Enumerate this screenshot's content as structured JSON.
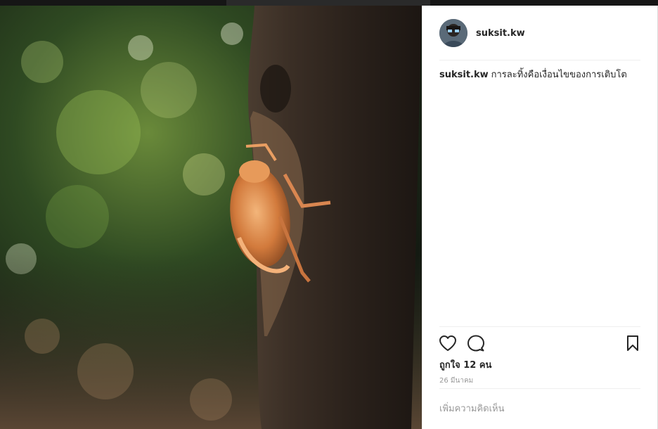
{
  "post": {
    "username": "suksit.kw",
    "caption_text": "การละทิ้งคือเงื่อนไขของการเติบโต",
    "likes_text": "ถูกใจ 12 คน",
    "date_text": "26 มีนาคม",
    "comment_placeholder": "เพิ่มความคิดเห็น"
  },
  "icons": {
    "like": "heart-outline",
    "comment": "speech-bubble",
    "save": "bookmark-outline"
  },
  "colors": {
    "text": "#262626",
    "muted": "#999999",
    "divider": "#efefef"
  }
}
